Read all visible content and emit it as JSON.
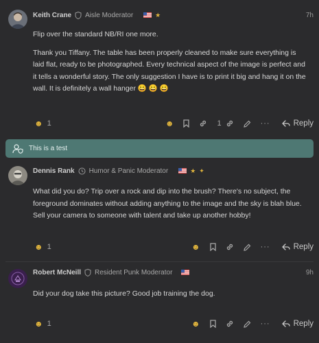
{
  "posts": [
    {
      "username": "Keith Crane",
      "user_title": "Aisle Moderator",
      "time": "7h",
      "body": [
        "Flip over the standard NB/RI one more.",
        "Thank you Tiffany. The table has been properly cleaned to make sure everything is laid flat, ready to be photographed. Every technical aspect of the image is perfect and it tells a wonderful story. The only suggestion I have is to print it big and hang it on the wall. It is definitely a wall hanger 😀 😀 😀"
      ],
      "reaction_count": "1",
      "link_count": "1"
    },
    {
      "username": "Dennis Rank",
      "user_title": "Humor & Panic Moderator",
      "time": "",
      "body": [
        "What did you do? Trip over a rock and dip into the brush? There's no subject, the foreground dominates without adding anything to the image and the sky is blah blue. Sell your camera to someone with talent and take up another hobby!"
      ],
      "reaction_count": "1"
    },
    {
      "username": "Robert McNeill",
      "user_title": "Resident Punk Moderator",
      "time": "9h",
      "body": [
        "Did your dog take this picture? Good job training the dog."
      ],
      "reaction_count": "1"
    }
  ],
  "notice": {
    "text": "This is a test"
  },
  "actions": {
    "reply_label": "Reply"
  },
  "icons": {
    "badge": "shield-icon",
    "flag": "us-flag-icon",
    "reaction": "smile-icon",
    "bookmark": "bookmark-icon",
    "link": "link-icon",
    "edit": "pencil-icon",
    "more": "ellipsis-icon",
    "reply": "reply-arrow-icon",
    "notice": "user-shield-icon"
  },
  "colors": {
    "background": "#2b2b2d",
    "notice_bg": "#4e7873",
    "text": "#d8d8d8",
    "muted": "#a8a8a8",
    "emoji": "#e0b43d"
  }
}
